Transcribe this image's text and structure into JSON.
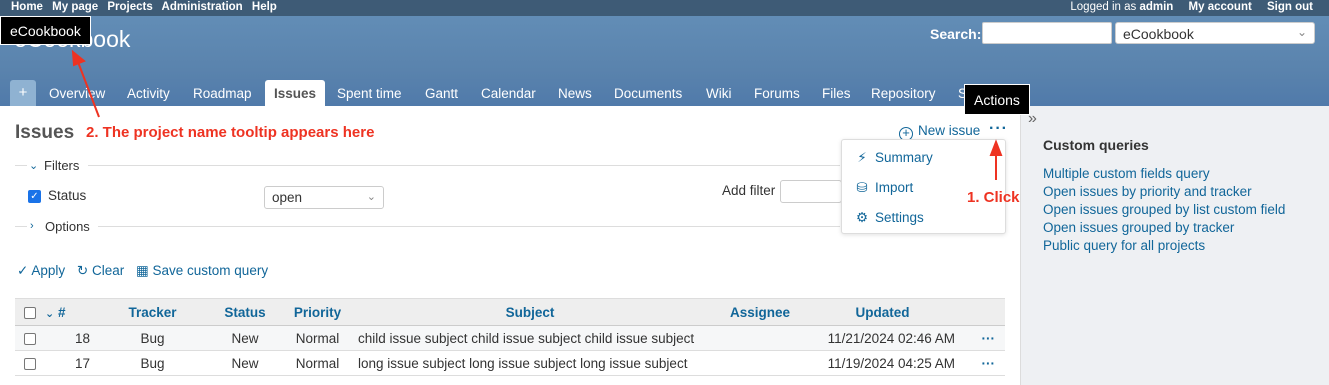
{
  "top_menu": {
    "items": [
      "Home",
      "My page",
      "Projects",
      "Administration",
      "Help"
    ],
    "logged_in_prefix": "Logged in as ",
    "logged_in_user": "admin",
    "my_account": "My account",
    "sign_out": "Sign out"
  },
  "header": {
    "project_title": "eCookbook",
    "search_label": "Search:",
    "search_value": "",
    "project_jump": "eCookbook"
  },
  "tabs": [
    "+",
    "Overview",
    "Activity",
    "Roadmap",
    "Issues",
    "Spent time",
    "Gantt",
    "Calendar",
    "News",
    "Documents",
    "Wiki",
    "Forums",
    "Files",
    "Repository",
    "S"
  ],
  "selected_tab": "Issues",
  "page_title": "Issues",
  "annotations": {
    "tooltip_note": "2. The project name tooltip appears here",
    "click_note": "1. Click"
  },
  "tooltips": {
    "project_name": "eCookbook",
    "actions": "Actions"
  },
  "new_issue_label": "New issue",
  "actions_menu": [
    "Summary",
    "Import",
    "Settings"
  ],
  "filters": {
    "legend": "Filters",
    "status_label": "Status",
    "status_value": "open",
    "add_filter_label": "Add filter",
    "options_legend": "Options"
  },
  "buttons": {
    "apply": "Apply",
    "clear": "Clear",
    "save": "Save custom query"
  },
  "table": {
    "headers": [
      "#",
      "Tracker",
      "Status",
      "Priority",
      "Subject",
      "Assignee",
      "Updated"
    ],
    "rows": [
      {
        "id": "18",
        "tracker": "Bug",
        "status": "New",
        "priority": "Normal",
        "subject": "child issue subject child issue subject child issue subject",
        "assignee": "",
        "updated": "11/21/2024 02:46 AM"
      },
      {
        "id": "17",
        "tracker": "Bug",
        "status": "New",
        "priority": "Normal",
        "subject": "long issue subject long issue subject long issue subject",
        "assignee": "",
        "updated": "11/19/2024 04:25 AM"
      }
    ]
  },
  "sidebar": {
    "title": "Custom queries",
    "queries": [
      "Multiple custom fields query",
      "Open issues by priority and tracker",
      "Open issues grouped by list custom field",
      "Open issues grouped by tracker",
      "Public query for all projects"
    ]
  },
  "colors": {
    "header_blue": "#628db6",
    "top_menu": "#3e5b76",
    "link": "#169",
    "annotation_red": "#e32"
  }
}
